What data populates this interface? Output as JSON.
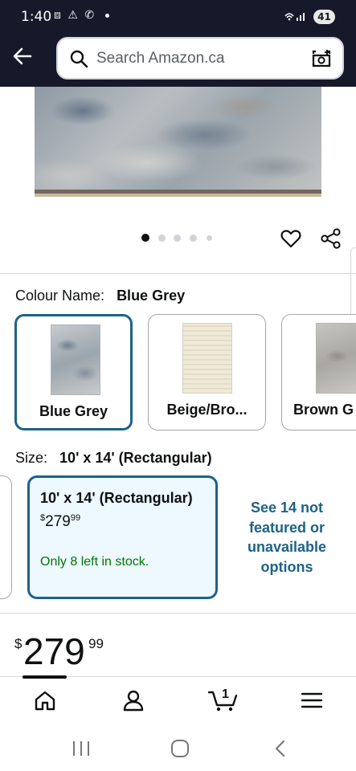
{
  "status_bar": {
    "time": "1:40",
    "left_icons": "⧈ ⚠ ✆",
    "battery": "41"
  },
  "search": {
    "placeholder": "Search Amazon.ca"
  },
  "carousel": {
    "dot_count": 5,
    "active_index": 0
  },
  "colour": {
    "label": "Colour Name:",
    "selected": "Blue Grey",
    "options": [
      {
        "name": "Blue Grey",
        "selected": true
      },
      {
        "name": "Beige/Bro...",
        "selected": false
      },
      {
        "name": "Brown G",
        "selected": false
      }
    ]
  },
  "size": {
    "label": "Size:",
    "selected": "10' x 14' (Rectangular)",
    "card": {
      "title": "10' x 14' (Rectangular)",
      "currency": "$",
      "price_whole": "279",
      "price_fraction": "99",
      "stock": "Only 8 left in stock."
    },
    "see_more": "See 14 not featured or unavailable options"
  },
  "price": {
    "currency": "$",
    "whole": "279",
    "fraction": "99"
  },
  "cart": {
    "count": "1"
  },
  "colors": {
    "header_bg": "#15192a",
    "selected_border": "#1d6288",
    "stock_green": "#007600",
    "link_blue": "#1d6288"
  },
  "bottom_nav": {
    "icons": [
      "home-icon",
      "account-icon",
      "cart-icon",
      "menu-icon"
    ]
  }
}
